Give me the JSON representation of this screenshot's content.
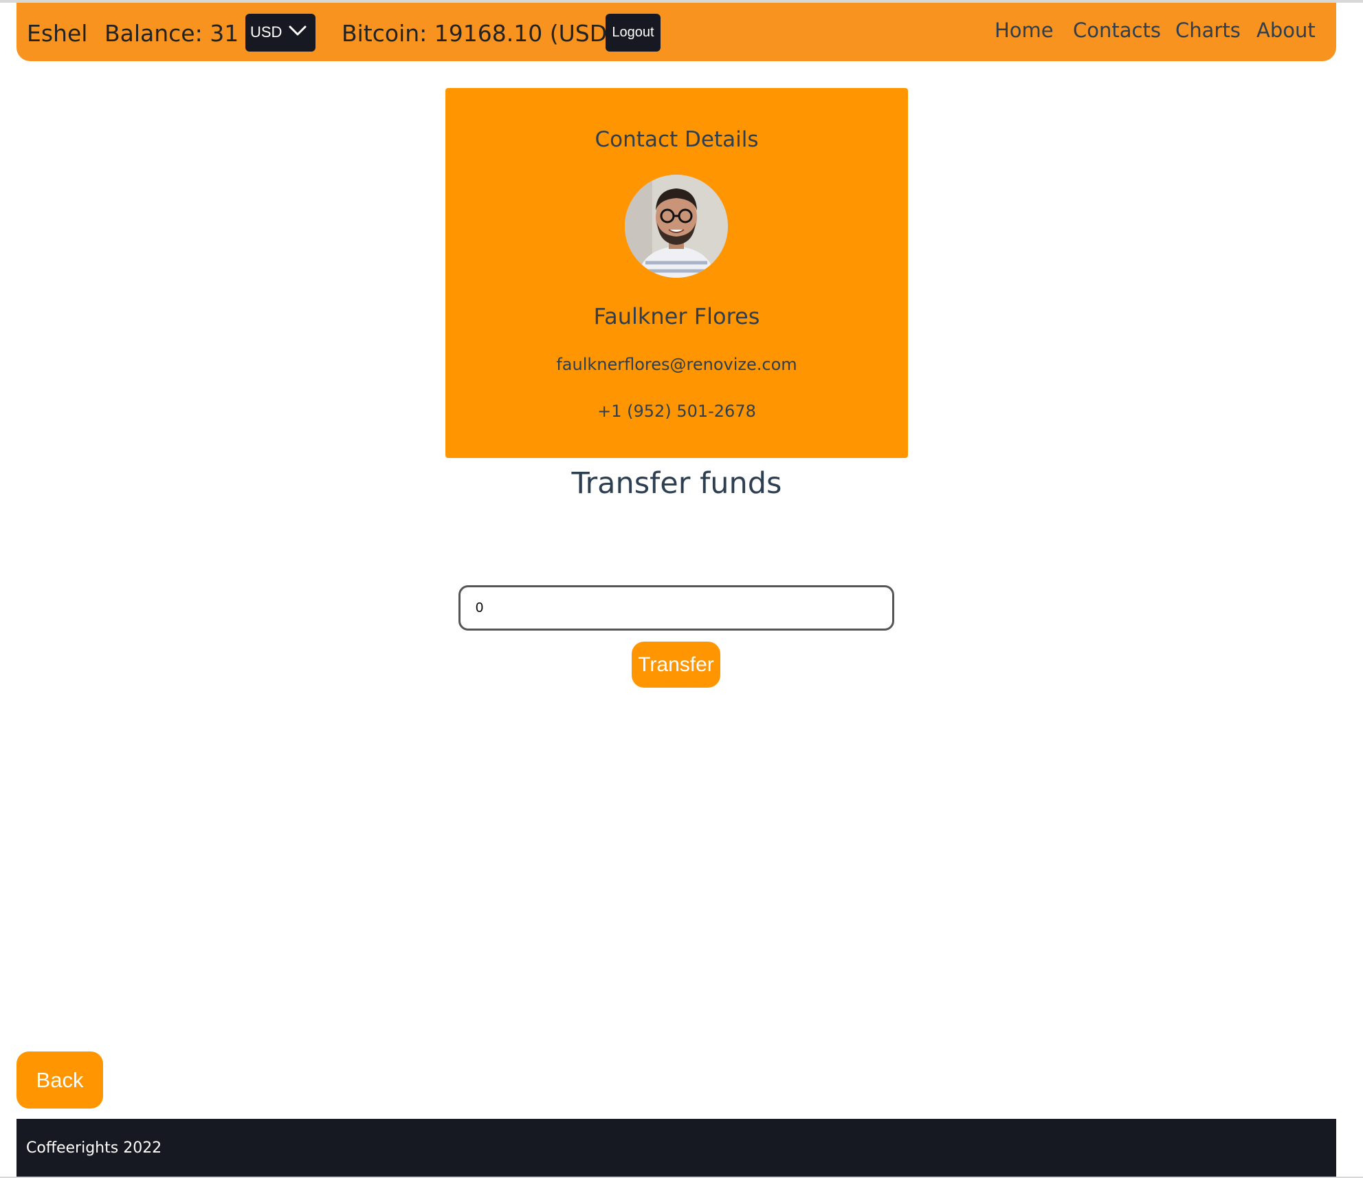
{
  "navbar": {
    "user_name": "Eshel",
    "balance_text": "Balance: 31",
    "currency": {
      "selected": "USD",
      "icon": "chevron-down-icon"
    },
    "bitcoin_text": "Bitcoin: 19168.10 (USD)",
    "logout_label": "Logout",
    "links": [
      {
        "label": "Home"
      },
      {
        "label": "Contacts"
      },
      {
        "label": "Charts"
      },
      {
        "label": "About"
      }
    ],
    "color": "#f7931e"
  },
  "contact_card": {
    "title": "Contact Details",
    "avatar_icon": "avatar-photo",
    "name": "Faulkner Flores",
    "email": "faulknerflores@renovize.com",
    "phone": "+1 (952) 501-2678",
    "color": "#ff9500"
  },
  "transfer": {
    "heading": "Transfer funds",
    "amount_value": "0",
    "button_label": "Transfer"
  },
  "back_label": "Back",
  "footer": {
    "text": "Coffeerights 2022",
    "color": "#161922"
  }
}
